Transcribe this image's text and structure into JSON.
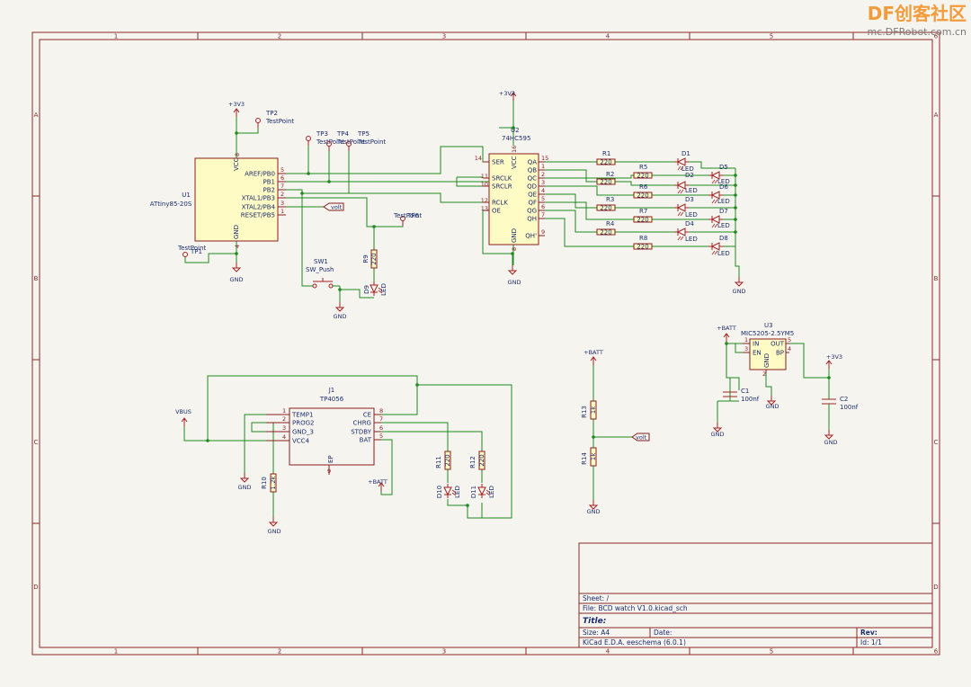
{
  "watermark": {
    "brand": "DF创客社区",
    "url": "mc.DFRobot.com.cn"
  },
  "frame": {
    "columns": [
      "1",
      "2",
      "3",
      "4",
      "5",
      "6"
    ],
    "rows": [
      "A",
      "B",
      "C",
      "D"
    ]
  },
  "components": {
    "u1": {
      "ref": "U1",
      "value": "ATtiny85-20S",
      "pins": [
        "AREF/PB0",
        "PB1",
        "PB2",
        "XTAL1/PB3",
        "XTAL2/PB4",
        "RESET/PB5"
      ],
      "pin_numbers": [
        "5",
        "6",
        "7",
        "2",
        "3",
        "1"
      ],
      "vcc_label": "VCC",
      "vcc_num": "8",
      "gnd_label": "GND",
      "gnd_num": "4"
    },
    "u2": {
      "ref": "U2",
      "value": "74HC595",
      "left_pins": [
        "SER",
        "SRCLK",
        "SRCLR",
        "RCLK",
        "OE"
      ],
      "left_nums": [
        "14",
        "11",
        "10",
        "12",
        "13"
      ],
      "right_pins": [
        "QA",
        "QB",
        "QC",
        "QD",
        "QE",
        "QF",
        "QG",
        "QH",
        "QH'"
      ],
      "right_nums": [
        "15",
        "1",
        "2",
        "3",
        "4",
        "5",
        "6",
        "7",
        "9"
      ],
      "vcc_label": "VCC",
      "vcc_num": "16",
      "gnd_label": "GND",
      "gnd_num": "8"
    },
    "u3": {
      "ref": "U3",
      "value": "MIC5205-2.5YM5",
      "pins": [
        "IN",
        "EN",
        "OUT",
        "BP",
        "GND"
      ],
      "pin_numbers": [
        "1",
        "3",
        "5",
        "4",
        "2"
      ]
    },
    "j1": {
      "ref": "J1",
      "value": "TP4056",
      "left_pins": [
        "TEMP1",
        "PROG2",
        "GND_3",
        "VCC4"
      ],
      "left_nums": [
        "1",
        "2",
        "3",
        "4"
      ],
      "right_pins": [
        "CE",
        "CHRG",
        "STDBY",
        "BAT"
      ],
      "right_nums": [
        "8",
        "7",
        "6",
        "5"
      ],
      "ep_label": "EP",
      "ep_num": "9"
    },
    "sw1": {
      "ref": "SW1",
      "value": "SW_Push"
    },
    "testpoints": {
      "tp1": "TP1",
      "tp2": "TP2",
      "tp3": "TP3",
      "tp4": "TP4",
      "tp5": "TP5",
      "tp6": "TP6",
      "value": "TestPoint"
    },
    "resistors": [
      {
        "ref": "R1",
        "value": "220"
      },
      {
        "ref": "R2",
        "value": "220"
      },
      {
        "ref": "R3",
        "value": "220"
      },
      {
        "ref": "R4",
        "value": "220"
      },
      {
        "ref": "R5",
        "value": "220"
      },
      {
        "ref": "R6",
        "value": "220"
      },
      {
        "ref": "R7",
        "value": "220"
      },
      {
        "ref": "R8",
        "value": "220"
      },
      {
        "ref": "R9",
        "value": "220"
      },
      {
        "ref": "R10",
        "value": "1.2k"
      },
      {
        "ref": "R11",
        "value": "220"
      },
      {
        "ref": "R12",
        "value": "220"
      },
      {
        "ref": "R13",
        "value": "1k"
      },
      {
        "ref": "R14",
        "value": "1k"
      }
    ],
    "leds": [
      {
        "ref": "D1",
        "value": "LED"
      },
      {
        "ref": "D2",
        "value": "LED"
      },
      {
        "ref": "D3",
        "value": "LED"
      },
      {
        "ref": "D4",
        "value": "LED"
      },
      {
        "ref": "D5",
        "value": "LED"
      },
      {
        "ref": "D6",
        "value": "LED"
      },
      {
        "ref": "D7",
        "value": "LED"
      },
      {
        "ref": "D8",
        "value": "LED"
      },
      {
        "ref": "D9",
        "value": "LED"
      },
      {
        "ref": "D10",
        "value": "LED"
      },
      {
        "ref": "D11",
        "value": "LED"
      }
    ],
    "c1": {
      "ref": "C1",
      "value": "100nf"
    },
    "c2": {
      "ref": "C2",
      "value": "100nf"
    }
  },
  "power": {
    "v33": "+3V3",
    "gnd": "GND",
    "batt": "+BATT",
    "vbus": "VBUS"
  },
  "labels": {
    "volt": "volt"
  },
  "title_block": {
    "sheet": "Sheet: /",
    "file": "File: BCD watch V1.0.kicad_sch",
    "title": "Title:",
    "size": "Size: A4",
    "date": "Date:",
    "rev": "Rev:",
    "tool": "KiCad E.D.A.  eeschema (6.0.1)",
    "id": "Id: 1/1"
  }
}
